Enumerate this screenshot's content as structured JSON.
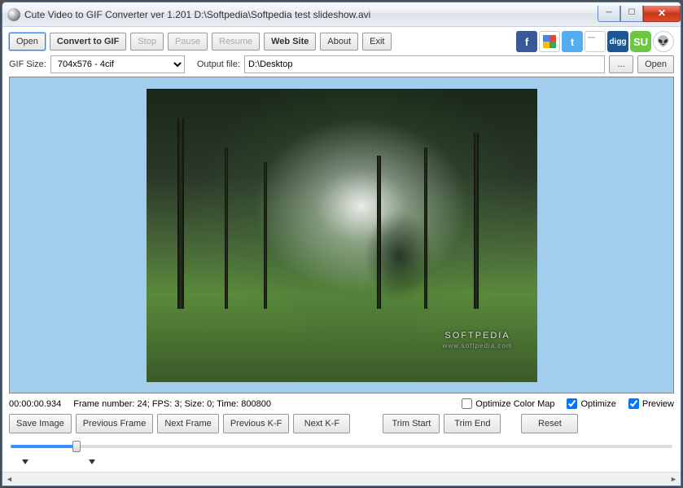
{
  "title": "Cute Video to GIF Converter ver 1.201  D:\\Softpedia\\Softpedia test slideshow.avi",
  "toolbar": {
    "open": "Open",
    "convert": "Convert to GIF",
    "stop": "Stop",
    "pause": "Pause",
    "resume": "Resume",
    "website": "Web Site",
    "about": "About",
    "exit": "Exit"
  },
  "gif_size_label": "GIF Size:",
  "gif_size_value": "704x576 - 4cif",
  "output_label": "Output file:",
  "output_value": "D:\\Desktop",
  "browse": "...",
  "open2": "Open",
  "watermark": "SOFTPEDIA",
  "watermark_sub": "www.softpedia.com",
  "status": {
    "time": "00:00:00.934",
    "info": "Frame number: 24; FPS: 3; Size: 0; Time: 800800"
  },
  "checks": {
    "opt_colormap": "Optimize Color Map",
    "optimize": "Optimize",
    "preview": "Preview"
  },
  "btns": {
    "save_image": "Save Image",
    "prev_frame": "Previous Frame",
    "next_frame": "Next Frame",
    "prev_kf": "Previous K-F",
    "next_kf": "Next K-F",
    "trim_start": "Trim Start",
    "trim_end": "Trim End",
    "reset": "Reset"
  }
}
